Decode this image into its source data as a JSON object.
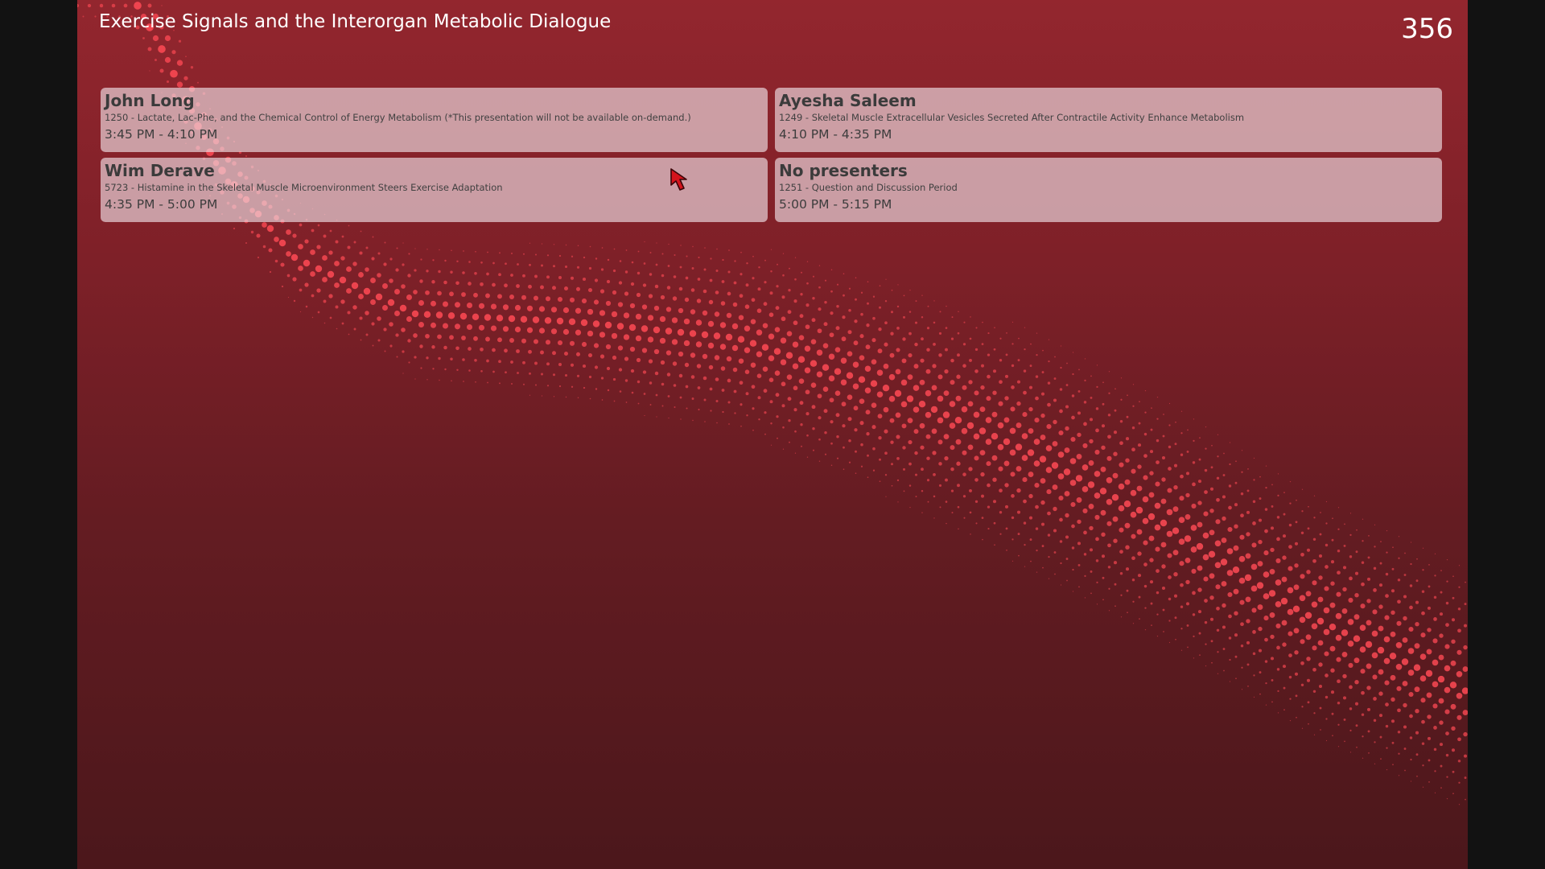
{
  "header": {
    "title": "Exercise Signals and the Interorgan Metabolic Dialogue",
    "room_number": "356"
  },
  "sessions": [
    {
      "presenter": "John Long",
      "abstract": "1250 - Lactate, Lac-Phe, and the Chemical Control of Energy Metabolism (*This presentation will not be available on-demand.)",
      "time": "3:45 PM - 4:10 PM"
    },
    {
      "presenter": "Ayesha Saleem",
      "abstract": "1249 - Skeletal Muscle Extracellular Vesicles Secreted After Contractile Activity Enhance Metabolism",
      "time": "4:10 PM - 4:35 PM"
    },
    {
      "presenter": "Wim Derave",
      "abstract": "5723 - Histamine in the Skeletal Muscle Microenvironment Steers Exercise Adaptation",
      "time": "4:35 PM - 5:00 PM"
    },
    {
      "presenter": "No presenters",
      "abstract": "1251 - Question and Discussion Period",
      "time": "5:00 PM - 5:15 PM"
    }
  ],
  "colors": {
    "background_top": "#93262e",
    "background_bottom": "#4b171b",
    "dot_color": "#ff4a55",
    "card_fill": "#eedee4",
    "letterbox": "#121212"
  },
  "icons": {
    "cursor": "red-arrow-cursor-icon",
    "background": "halftone-dot-wave-pattern"
  }
}
